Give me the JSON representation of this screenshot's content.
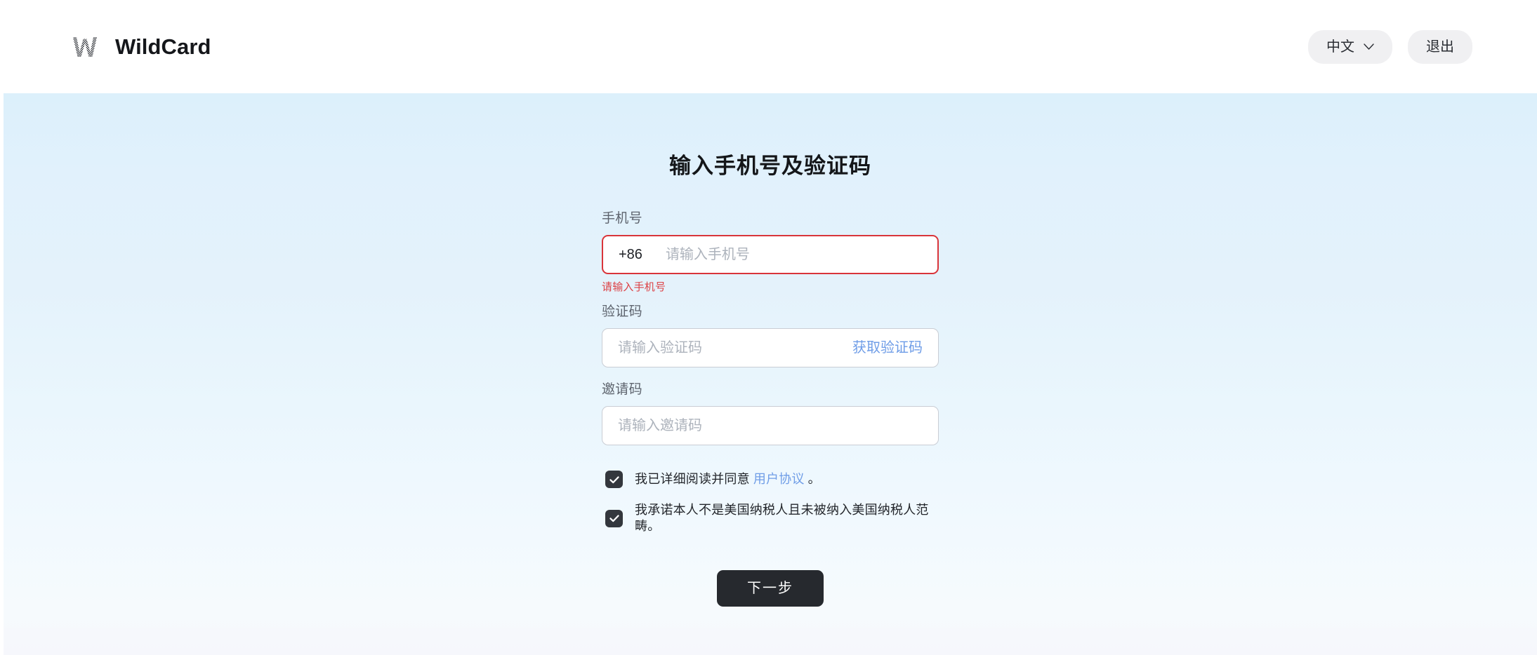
{
  "header": {
    "brand_name": "WildCard",
    "logo_icon": "wildcard-w-logo",
    "language_button": {
      "label": "中文",
      "chevron_icon": "chevron-down-icon"
    },
    "logout_button": {
      "label": "退出"
    }
  },
  "form": {
    "title": "输入手机号及验证码",
    "phone": {
      "label": "手机号",
      "country_code": "+86",
      "value": "",
      "placeholder": "请输入手机号",
      "error": "请输入手机号",
      "has_error": true
    },
    "verification_code": {
      "label": "验证码",
      "value": "",
      "placeholder": "请输入验证码",
      "action_label": "获取验证码"
    },
    "invite_code": {
      "label": "邀请码",
      "value": "",
      "placeholder": "请输入邀请码"
    },
    "agreements": [
      {
        "checked": true,
        "prefix": "我已详细阅读并同意",
        "link": "用户协议",
        "suffix": "。",
        "check_icon": "checkmark-icon"
      },
      {
        "checked": true,
        "prefix": "我承诺本人不是美国纳税人且未被纳入美国纳税人范畴。",
        "link": "",
        "suffix": "",
        "check_icon": "checkmark-icon"
      }
    ],
    "submit_label": "下一步"
  },
  "colors": {
    "accent_link": "#6f9de7",
    "error": "#dc4145",
    "submit_bg": "#26292e",
    "checkbox_bg": "#33373d",
    "page_top": "#dcf0fb",
    "page_bottom": "#f6f8fc"
  }
}
